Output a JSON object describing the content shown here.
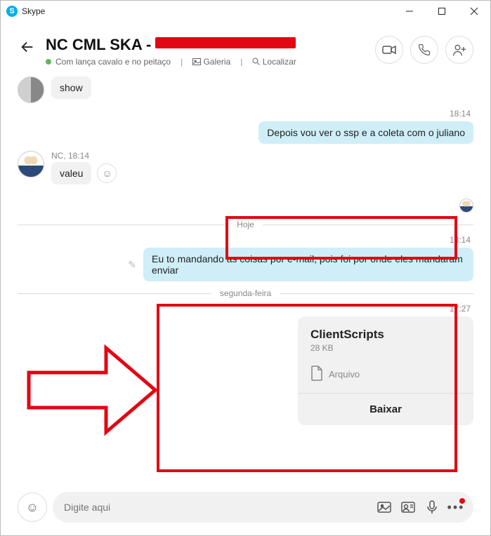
{
  "window": {
    "app_name": "Skype"
  },
  "header": {
    "title_prefix": "NC CML SKA -",
    "status_text": "Com lança cavalo e no peitaço",
    "gallery_label": "Galeria",
    "search_label": "Localizar"
  },
  "messages": {
    "m1": {
      "text": "show"
    },
    "t1": "18:14",
    "m2": {
      "text": "Depois vou ver o ssp e a coleta com o juliano"
    },
    "m3_meta": "NC, 18:14",
    "m3": {
      "text": "valeu"
    },
    "sep1": "Hoje",
    "t2": "13:14",
    "m4": {
      "text": "Eu to mandando as coisas por e-mail, pois foi por onde eles mandaram enviar"
    },
    "sep2": "segunda-feira",
    "t3": "17:27",
    "file": {
      "name": "ClientScripts",
      "size": "28 KB",
      "type_label": "Arquivo",
      "download_label": "Baixar"
    }
  },
  "composer": {
    "placeholder": "Digite aqui"
  }
}
